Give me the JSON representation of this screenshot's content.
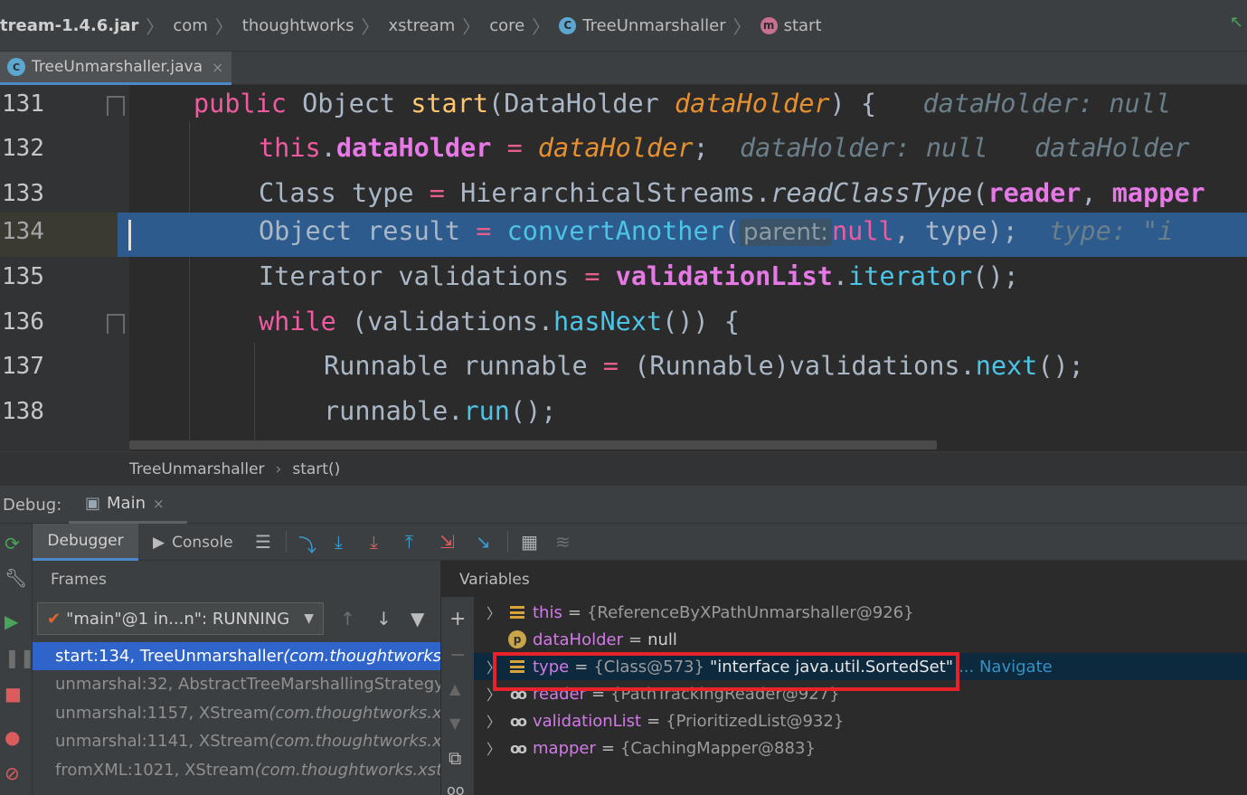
{
  "navbar": {
    "crumbs": [
      {
        "label": "tream-1.4.6.jar",
        "icon": ""
      },
      {
        "label": "com",
        "icon": ""
      },
      {
        "label": "thoughtworks",
        "icon": ""
      },
      {
        "label": "xstream",
        "icon": ""
      },
      {
        "label": "core",
        "icon": ""
      },
      {
        "label": "TreeUnmarshaller",
        "icon": "class-icon"
      },
      {
        "label": "start",
        "icon": "method-icon"
      }
    ],
    "badge_class": "C",
    "badge_method": "m"
  },
  "file_tab": {
    "label": "TreeUnmarshaller.java",
    "close": "×"
  },
  "editor": {
    "lines": [
      {
        "no": "131"
      },
      {
        "no": "132"
      },
      {
        "no": "133"
      },
      {
        "no": "134"
      },
      {
        "no": "135"
      },
      {
        "no": "136"
      },
      {
        "no": "137"
      },
      {
        "no": "138"
      }
    ],
    "l131": {
      "t1": "public",
      "t2": " Object ",
      "t3": "start",
      "t4": "(DataHolder ",
      "t5": "dataHolder",
      "t6": ") {",
      "hint": "dataHolder: null"
    },
    "l132": {
      "t1": "this",
      "t2": ".",
      "t3": "dataHolder",
      "t4": " = ",
      "t5": "dataHolder",
      "t6": ";",
      "hint": "dataHolder: null   dataHolder"
    },
    "l133": {
      "t1": "Class type ",
      "t2": "=",
      "t3": " HierarchicalStreams.",
      "t4": "readClassType",
      "t5": "(",
      "t6": "reader",
      "t7": ", ",
      "t8": "mapper"
    },
    "l134": {
      "t1": "Object result ",
      "t2": "=",
      "t3": " ",
      "t4": "convertAnother",
      "t5": "(",
      "param": "parent:",
      "t6": "null",
      "t7": ", type);",
      "hint": "type: \"i"
    },
    "l135": {
      "t1": "Iterator validations ",
      "t2": "=",
      "t3": " ",
      "t4": "validationList",
      "t5": ".",
      "t6": "iterator",
      "t7": "();"
    },
    "l136": {
      "t1": "while",
      "t2": " (validations.",
      "t3": "hasNext",
      "t4": "()) {"
    },
    "l137": {
      "t1": "Runnable runnable ",
      "t2": "=",
      "t3": " (Runnable)validations.",
      "t4": "next",
      "t5": "();"
    },
    "l138": {
      "t1": "runnable.",
      "t2": "run",
      "t3": "();"
    }
  },
  "editor_breadcrumb": {
    "cls": "TreeUnmarshaller",
    "sep": "›",
    "method": "start()"
  },
  "debug": {
    "label": "Debug:",
    "tab": "Main",
    "close": "×",
    "tabs": {
      "debugger": "Debugger",
      "console": "Console"
    },
    "frames_title": "Frames",
    "thread": "\"main\"@1 in...n\": RUNNING",
    "frames": [
      {
        "method": "start:134, TreeUnmarshaller ",
        "pkg": "(com.thoughtworks.xs"
      },
      {
        "method": "unmarshal:32, AbstractTreeMarshallingStrategy ",
        "pkg": "("
      },
      {
        "method": "unmarshal:1157, XStream ",
        "pkg": "(com.thoughtworks.xstr"
      },
      {
        "method": "unmarshal:1141, XStream ",
        "pkg": "(com.thoughtworks.xstr"
      },
      {
        "method": "fromXML:1021, XStream ",
        "pkg": "(com.thoughtworks.xstre"
      }
    ],
    "variables_title": "Variables",
    "variables": [
      {
        "name": "this",
        "eq": "=",
        "value": "{ReferenceByXPathUnmarshaller@926}",
        "str": "",
        "nav": "",
        "icon": "field-icon"
      },
      {
        "name": "dataHolder",
        "eq": "=",
        "value": "null",
        "str": "",
        "nav": "",
        "icon": "parameter-icon"
      },
      {
        "name": "type",
        "eq": "=",
        "value": "{Class@573}",
        "str": "\"interface java.util.SortedSet\"",
        "nav": "... Navigate",
        "icon": "field-icon"
      },
      {
        "name": "reader",
        "eq": "=",
        "value": "{PathTrackingReader@927}",
        "str": "",
        "nav": "",
        "icon": "watch-icon"
      },
      {
        "name": "validationList",
        "eq": "=",
        "value": "{PrioritizedList@932}",
        "str": "",
        "nav": "",
        "icon": "watch-icon"
      },
      {
        "name": "mapper",
        "eq": "=",
        "value": "{CachingMapper@883}",
        "str": "",
        "nav": "",
        "icon": "watch-icon"
      }
    ]
  },
  "colors": {
    "accent": "#4a88c7",
    "selection": "#2d5b8d",
    "highlight": "#e8222a"
  }
}
